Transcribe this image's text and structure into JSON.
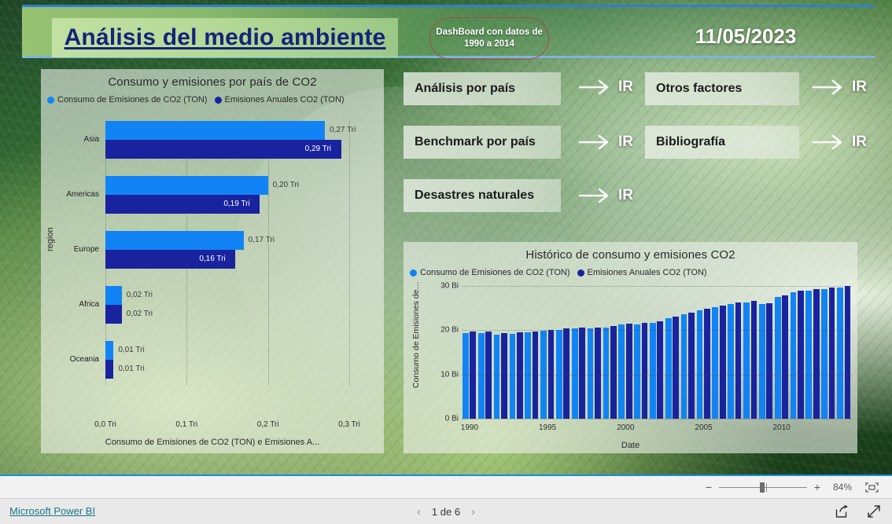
{
  "header": {
    "title": "Análisis del medio ambiente",
    "badge_line1": "DashBoard con datos de",
    "badge_line2": "1990 a 2014",
    "date": "11/05/2023"
  },
  "nav_buttons": [
    {
      "label": "Análisis por país",
      "action": "IR"
    },
    {
      "label": "Benchmark por país",
      "action": "IR"
    },
    {
      "label": "Desastres naturales",
      "action": "IR"
    },
    {
      "label": "Otros factores",
      "action": "IR"
    },
    {
      "label": "Bibliografía",
      "action": "IR"
    }
  ],
  "colors": {
    "series_consumo": "#1283f5",
    "series_emisiones": "#1a239e",
    "title_blue": "#16237a",
    "accent_blue": "#1a8cdb",
    "link_teal": "#17788a"
  },
  "footer": {
    "powerbi_link": "Microsoft Power BI",
    "page_indicator": "1 de 6",
    "prev_icon": "chevron-left-icon",
    "next_icon": "chevron-right-icon",
    "share_icon": "share-icon",
    "fullscreen_icon": "fullscreen-icon",
    "zoom_percent": "84%",
    "zoom_out_icon": "minus-icon",
    "zoom_in_icon": "plus-icon",
    "fit_page_icon": "fit-to-page-icon"
  },
  "chart_data": [
    {
      "type": "bar",
      "orientation": "horizontal",
      "title": "Consumo y emisiones por país de CO2",
      "categories": [
        "Asia",
        "Americas",
        "Europe",
        "Africa",
        "Oceania"
      ],
      "series": [
        {
          "name": "Consumo de Emisiones de CO2 (TON)",
          "color": "#1283f5",
          "values": [
            0.27,
            0.2,
            0.17,
            0.02,
            0.01
          ],
          "labels": [
            "0,27 Tri",
            "0,20 Tri",
            "0,17 Tri",
            "0,02 Tri",
            "0,01 Tri"
          ]
        },
        {
          "name": "Emisiones Anuales CO2 (TON)",
          "color": "#1a239e",
          "values": [
            0.29,
            0.19,
            0.16,
            0.02,
            0.01
          ],
          "labels": [
            "0,29 Tri",
            "0,19 Tri",
            "0,16 Tri",
            "0,02 Tri",
            "0,01 Tri"
          ]
        }
      ],
      "xlabel": "Consumo de Emisiones de CO2 (TON) e Emisiones A...",
      "ylabel": "region",
      "xticks": [
        "0,0 Tri",
        "0,1 Tri",
        "0,2 Tri",
        "0,3 Tri"
      ],
      "xlim": [
        0,
        0.3
      ],
      "grid": true,
      "legend_position": "top-left"
    },
    {
      "type": "bar",
      "orientation": "vertical",
      "title": "Histórico de consumo y emisiones CO2",
      "categories": [
        1990,
        1991,
        1992,
        1993,
        1994,
        1995,
        1996,
        1997,
        1998,
        1999,
        2000,
        2001,
        2002,
        2003,
        2004,
        2005,
        2006,
        2007,
        2008,
        2009,
        2010,
        2011,
        2012,
        2013,
        2014
      ],
      "series": [
        {
          "name": "Consumo de Emisiones de CO2 (TON)",
          "color": "#1283f5",
          "values": [
            21.2,
            21.3,
            20.9,
            21.1,
            21.4,
            21.8,
            22.1,
            22.4,
            22.4,
            22.7,
            23.4,
            23.5,
            23.9,
            25.0,
            26.0,
            26.9,
            27.8,
            28.6,
            28.9,
            28.5,
            30.3,
            31.5,
            31.9,
            32.3,
            32.6
          ]
        },
        {
          "name": "Emisiones Anuales CO2 (TON)",
          "color": "#1a239e",
          "values": [
            21.6,
            21.7,
            21.3,
            21.5,
            21.7,
            22.1,
            22.5,
            22.7,
            22.7,
            23.0,
            23.7,
            23.8,
            24.3,
            25.4,
            26.4,
            27.3,
            28.2,
            29.0,
            29.2,
            28.8,
            30.7,
            31.8,
            32.2,
            32.6,
            33.0
          ]
        }
      ],
      "xlabel": "Date",
      "ylabel": "Consumo de Emisiones de…",
      "yticks": [
        "0 Bi",
        "10 Bi",
        "20 Bi",
        "30 Bi"
      ],
      "ylim": [
        0,
        33
      ],
      "xticks": [
        "1990",
        "1995",
        "2000",
        "2005",
        "2010"
      ],
      "grid": true,
      "legend_position": "top-left"
    }
  ]
}
